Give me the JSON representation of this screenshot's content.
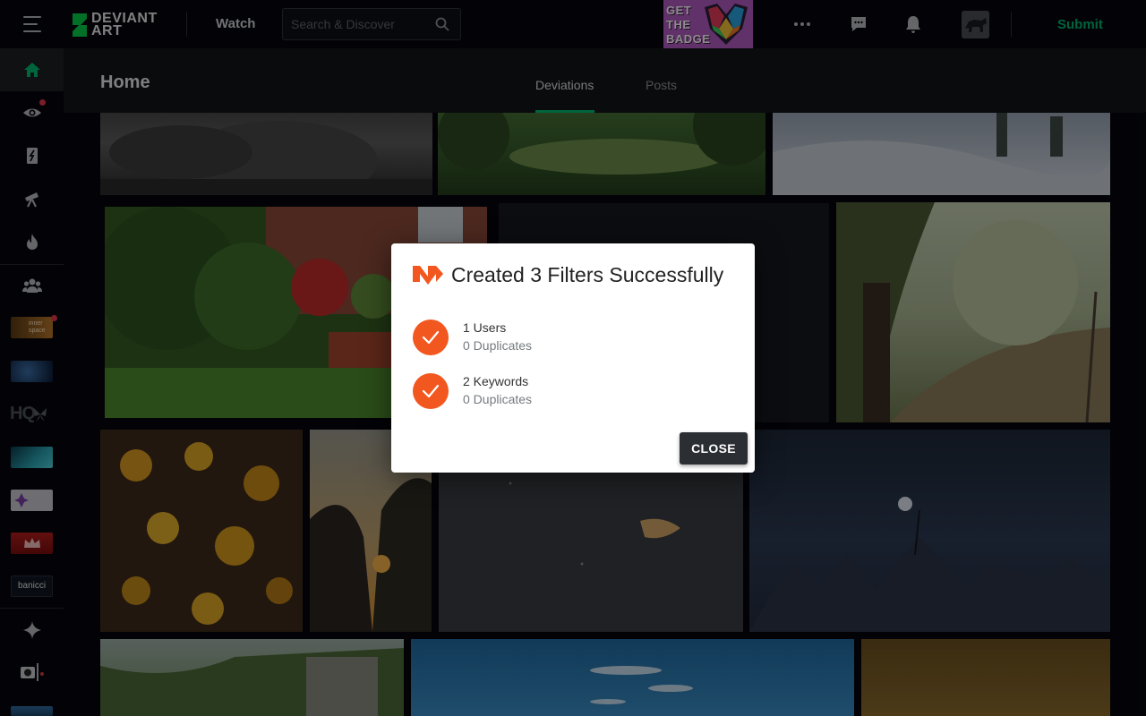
{
  "app": {
    "brand_line1": "DEVIANT",
    "brand_line2": "ART"
  },
  "topbar": {
    "watch_label": "Watch",
    "search_placeholder": "Search & Discover",
    "ad_text_line1": "GET",
    "ad_text_line2": "THE",
    "ad_text_line3": "BADGE",
    "submit_label": "Submit",
    "icons": [
      "more-icon",
      "messages-icon",
      "notifications-icon"
    ]
  },
  "rail": {
    "items": [
      "home-icon",
      "watch-feed-icon",
      "deviantart-icon",
      "discover-telescope-icon",
      "trending-flame-icon",
      "groups-icon"
    ],
    "groups": [
      "group-inner-space",
      "group-blue-space",
      "group-hq",
      "group-teal-wave",
      "group-purple",
      "group-red-crown",
      "group-banicci"
    ],
    "group_labels": {
      "inner_space": "inner space",
      "hq": "HQ",
      "banicci": "banicci"
    },
    "bottom": [
      "core-sparkle-icon",
      "user-camera-icon",
      "user-thumb"
    ]
  },
  "header": {
    "title": "Home",
    "tabs": [
      {
        "label": "Deviations",
        "active": true
      },
      {
        "label": "Posts",
        "active": false
      }
    ]
  },
  "modal": {
    "title": "Created 3 Filters Successfully",
    "results": [
      {
        "title": "1 Users",
        "subtitle": "0 Duplicates"
      },
      {
        "title": "2 Keywords",
        "subtitle": "0 Duplicates"
      }
    ],
    "close_label": "CLOSE"
  },
  "colors": {
    "accent_green": "#00b66f",
    "modal_orange": "#f2571f",
    "notification_red": "#e4344d",
    "background": "#06070d"
  }
}
